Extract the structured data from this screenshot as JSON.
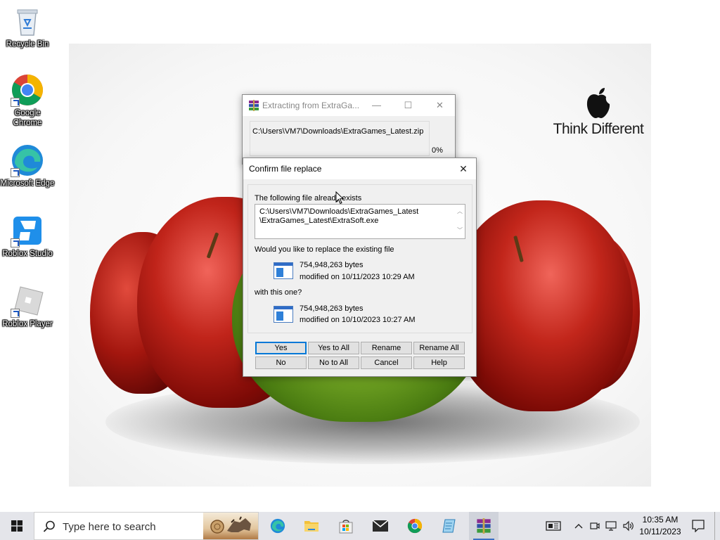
{
  "desktop": {
    "icons": [
      {
        "label": "Recycle Bin"
      },
      {
        "label": "Google Chrome"
      },
      {
        "label": "Microsoft Edge"
      },
      {
        "label": "Roblox Studio"
      },
      {
        "label": "Roblox Player"
      }
    ],
    "wallpaper_text": "Think Different"
  },
  "extract_window": {
    "title": "Extracting from ExtraGa...",
    "path": "C:\\Users\\VM7\\Downloads\\ExtraGames_Latest.zip",
    "progress": "0%"
  },
  "dialog": {
    "title": "Confirm file replace",
    "prompt": "The following file already exists",
    "path_line1": "C:\\Users\\VM7\\Downloads\\ExtraGames_Latest",
    "path_line2": "\\ExtraGames_Latest\\ExtraSoft.exe",
    "replace_question": "Would you like to replace the existing file",
    "existing_size": "754,948,263 bytes",
    "existing_modified": "modified on 10/11/2023 10:29 AM",
    "with_this_one": "with this one?",
    "new_size": "754,948,263 bytes",
    "new_modified": "modified on 10/10/2023 10:27 AM",
    "buttons": {
      "yes": "Yes",
      "yes_to_all": "Yes to All",
      "rename": "Rename",
      "rename_all": "Rename All",
      "no": "No",
      "no_to_all": "No to All",
      "cancel": "Cancel",
      "help": "Help"
    }
  },
  "taskbar": {
    "search_placeholder": "Type here to search",
    "time": "10:35 AM",
    "date": "10/11/2023",
    "accent": "#0078d7"
  }
}
